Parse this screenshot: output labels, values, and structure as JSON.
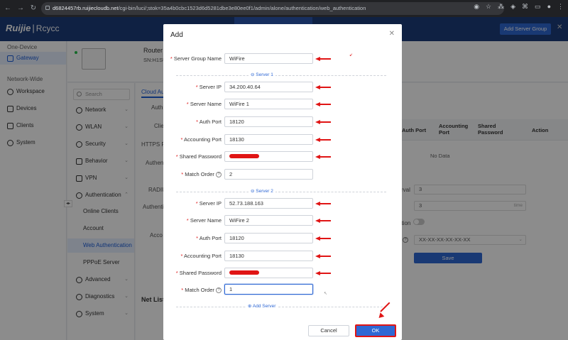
{
  "browser": {
    "url_host": "d6824457rb.ruijiecloudb.net",
    "url_path": "/cgi-bin/luci/;stok=35a4b0cbc1523d6d5281dbe3e80ee0f1/admin/alone/authentication/web_authentication"
  },
  "app": {
    "brand": "Ruijie",
    "brand_sub": "Rcycc",
    "add_server_group_top": "Add Server Group"
  },
  "leftnav": {
    "one_device": "One-Device",
    "gateway": "Gateway",
    "network_wide": "Network-Wide",
    "items": [
      "Workspace",
      "Devices",
      "Clients",
      "System"
    ]
  },
  "device": {
    "name": "Router",
    "sn": "SN:H1SU"
  },
  "subnav": {
    "search_placeholder": "Search",
    "items": [
      "Network",
      "WLAN",
      "Security",
      "Behavior",
      "VPN",
      "Authentication"
    ],
    "auth_sub": [
      "Online Clients",
      "Account",
      "Web Authentication",
      "PPPoE Server"
    ],
    "bottom": [
      "Advanced",
      "Diagnostics",
      "System"
    ]
  },
  "content": {
    "tab": "Cloud Aut",
    "labels": [
      "Auth",
      "Clie",
      "HTTPS Re",
      "Authen",
      "RADIU",
      "Authenti",
      "Acco",
      "Net List"
    ],
    "table_headers": [
      "Auth Port",
      "Accounting Port",
      "Shared Password",
      "Action"
    ],
    "no_data": "No Data",
    "interval_label": "rval",
    "interval_value": "3",
    "second_value": "3",
    "second_unit": "time",
    "toggle_label": "ation",
    "mac_value": "XX-XX-XX-XX-XX-XX",
    "save": "Save"
  },
  "modal": {
    "title": "Add",
    "server_group_label": "Server Group Name",
    "server_group_value": "WiFire",
    "server1_label": "Server 1",
    "server2_label": "Server 2",
    "labels": {
      "server_ip": "Server IP",
      "server_name": "Server Name",
      "auth_port": "Auth Port",
      "accounting_port": "Accounting Port",
      "shared_password": "Shared Password",
      "match_order": "Match Order"
    },
    "server1": {
      "ip": "34.200.40.64",
      "name": "WiFire 1",
      "auth_port": "18120",
      "accounting_port": "18130",
      "match_order": "2"
    },
    "server2": {
      "ip": "52.73.188.163",
      "name": "WiFire 2",
      "auth_port": "18120",
      "accounting_port": "18130",
      "match_order": "1"
    },
    "add_server": "Add Server",
    "cancel": "Cancel",
    "ok": "OK"
  },
  "colors": {
    "accent": "#2f68d4",
    "annotation": "#e01515",
    "header": "#1d3d7a"
  }
}
